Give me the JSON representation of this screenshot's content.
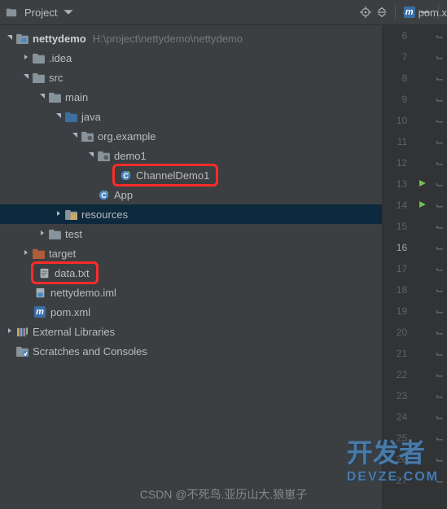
{
  "toolbar": {
    "title": "Project",
    "tab_file": "pom.x"
  },
  "tree": {
    "root": {
      "name": "nettydemo",
      "path": "H:\\project\\nettydemo\\nettydemo"
    },
    "idea": ".idea",
    "src": "src",
    "main": "main",
    "java": "java",
    "pkg": "org.example",
    "demo1": "demo1",
    "channelDemo": "ChannelDemo1",
    "app": "App",
    "resources": "resources",
    "test": "test",
    "target": "target",
    "datatxt": "data.txt",
    "iml": "nettydemo.iml",
    "pom": "pom.xml",
    "extlib": "External Libraries",
    "scratches": "Scratches and Consoles"
  },
  "gutter": {
    "lines": [
      "6",
      "7",
      "8",
      "9",
      "10",
      "11",
      "12",
      "13",
      "14",
      "15",
      "16",
      "17",
      "18",
      "19",
      "20",
      "21",
      "22",
      "23",
      "24",
      "25",
      "26",
      "27"
    ],
    "run_lines": [
      "13",
      "14"
    ],
    "current": "16"
  },
  "watermark": {
    "line1": "开发者",
    "line2": "DEVZE.COM",
    "csdn": "CSDN @不死鸟.亚历山大.狼崽子"
  }
}
